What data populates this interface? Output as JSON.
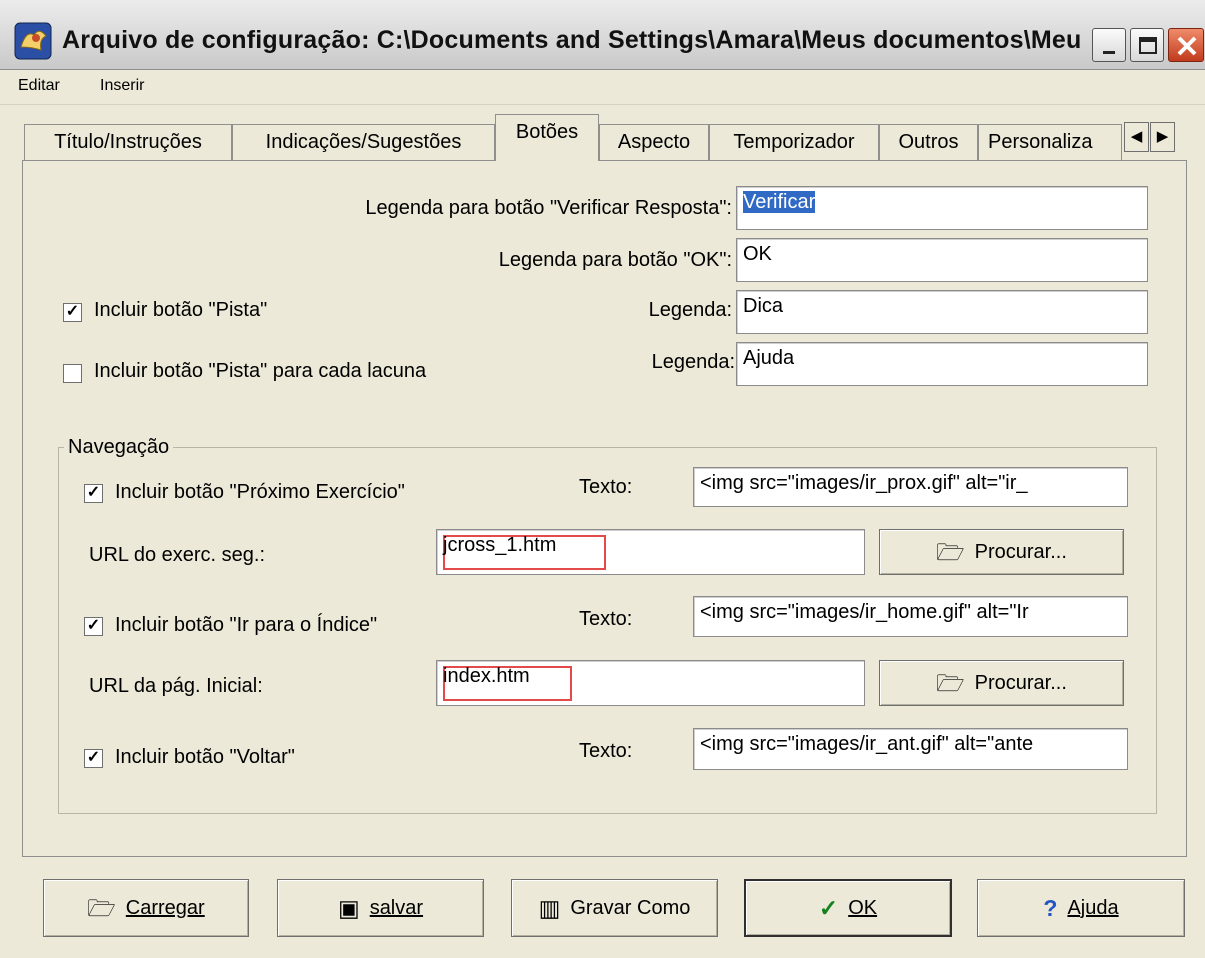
{
  "window": {
    "title": "Arquivo de configuração: C:\\Documents and Settings\\Amara\\Meus documentos\\Meus ..."
  },
  "menu": {
    "items": [
      "Editar",
      "Inserir"
    ]
  },
  "tabs": [
    {
      "label": "Título/Instruções"
    },
    {
      "label": "Indicações/Sugestões"
    },
    {
      "label": "Botões",
      "active": true
    },
    {
      "label": "Aspecto"
    },
    {
      "label": "Temporizador"
    },
    {
      "label": "Outros"
    },
    {
      "label": "Personaliza"
    }
  ],
  "tab_scroll": {
    "left": "◀",
    "right": "▶"
  },
  "captions": {
    "verify_label": "Legenda para botão \"Verificar Resposta\":",
    "verify_value": "Verificar",
    "ok_label": "Legenda para botão \"OK\":",
    "ok_value": "OK",
    "hint_checkbox": "Incluir botão \"Pista\"",
    "hint_checked": true,
    "hint_caption_label": "Legenda:",
    "hint_caption_value": "Dica",
    "gap_hint_checkbox": "Incluir botão \"Pista\" para cada lacuna",
    "gap_hint_checked": false,
    "gap_hint_caption_label": "Legenda:",
    "gap_hint_caption_value": "Ajuda"
  },
  "navigation": {
    "title": "Navegação",
    "next_checkbox": "Incluir botão \"Próximo Exercício\"",
    "next_checked": true,
    "next_text_label": "Texto:",
    "next_text_value": "<img src=\"images/ir_prox.gif\" alt=\"ir_",
    "next_url_label": "URL do exerc. seg.:",
    "next_url_value": "jcross_1.htm",
    "index_checkbox": "Incluir botão \"Ir para o Índice\"",
    "index_checked": true,
    "index_text_label": "Texto:",
    "index_text_value": "<img src=\"images/ir_home.gif\" alt=\"Ir",
    "home_url_label": "URL da pág. Inicial:",
    "home_url_value": "index.htm",
    "back_checkbox": "Incluir botão \"Voltar\"",
    "back_checked": true,
    "back_text_label": "Texto:",
    "back_text_value": "<img src=\"images/ir_ant.gif\" alt=\"ante",
    "browse_label": "Procurar..."
  },
  "buttons": {
    "load": "Carregar",
    "save": "salvar",
    "save_as": "Gravar Como",
    "ok": "OK",
    "help": "Ajuda"
  },
  "icons": {
    "folder": "folder-open-icon",
    "save": "floppy-disk-icon",
    "save_as": "save-as-icon",
    "ok": "checkmark-icon",
    "help": "question-mark-icon"
  }
}
